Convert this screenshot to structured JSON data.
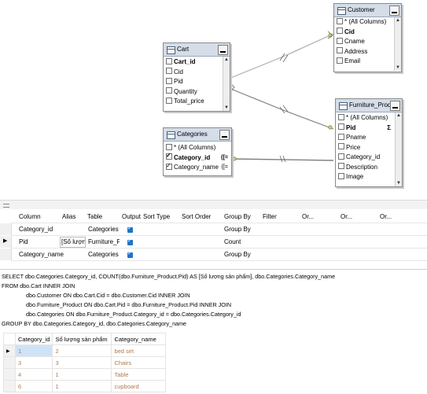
{
  "diagram": {
    "tables": [
      {
        "key": "customer",
        "title": "Customer",
        "rows": [
          {
            "label": "* (All Columns)",
            "checked": false,
            "bold": false
          },
          {
            "label": "Cid",
            "checked": false,
            "bold": true
          },
          {
            "label": "Cname",
            "checked": false,
            "bold": false
          },
          {
            "label": "Address",
            "checked": false,
            "bold": false
          },
          {
            "label": "Email",
            "checked": false,
            "bold": false
          }
        ]
      },
      {
        "key": "cart",
        "title": "Cart",
        "rows": [
          {
            "label": "Cart_id",
            "checked": false,
            "bold": true
          },
          {
            "label": "Cid",
            "checked": false,
            "bold": false
          },
          {
            "label": "Pid",
            "checked": false,
            "bold": false
          },
          {
            "label": "Quantity",
            "checked": false,
            "bold": false
          },
          {
            "label": "Total_price",
            "checked": false,
            "bold": false
          }
        ]
      },
      {
        "key": "categories",
        "title": "Categories",
        "rows": [
          {
            "label": "* (All Columns)",
            "checked": false,
            "bold": false
          },
          {
            "label": "Category_id",
            "checked": true,
            "bold": true
          },
          {
            "label": "Category_name",
            "checked": true,
            "bold": false
          }
        ]
      },
      {
        "key": "furniture",
        "title": "Furniture_Product",
        "rows": [
          {
            "label": "* (All Columns)",
            "checked": false,
            "bold": false
          },
          {
            "label": "Pid",
            "checked": false,
            "bold": true
          },
          {
            "label": "Pname",
            "checked": false,
            "bold": false
          },
          {
            "label": "Price",
            "checked": false,
            "bold": false
          },
          {
            "label": "Category_id",
            "checked": false,
            "bold": false
          },
          {
            "label": "Description",
            "checked": false,
            "bold": false
          },
          {
            "label": "Image",
            "checked": false,
            "bold": false
          }
        ]
      }
    ],
    "sigma": "Σ",
    "groupby_icon": "{[="
  },
  "grid": {
    "headers": [
      "Column",
      "Alias",
      "Table",
      "Output",
      "Sort Type",
      "Sort Order",
      "Group By",
      "Filter",
      "Or...",
      "Or...",
      "Or..."
    ],
    "rows": [
      {
        "column": "Category_id",
        "alias": "",
        "table": "Categories",
        "output": true,
        "group_by": "Group By"
      },
      {
        "column": "Pid",
        "alias": "[Số lượng...",
        "table": "Furniture_P...",
        "output": true,
        "group_by": "Count"
      },
      {
        "column": "Category_name",
        "alias": "",
        "table": "Categories",
        "output": true,
        "group_by": "Group By"
      }
    ]
  },
  "sql": {
    "lines": [
      "SELECT dbo.Categories.Category_id, COUNT(dbo.Furniture_Product.Pid) AS [Số lượng sản phẩm], dbo.Categories.Category_name",
      "FROM      dbo.Cart INNER JOIN",
      "dbo.Customer ON dbo.Cart.Cid = dbo.Customer.Cid INNER JOIN",
      "dbo.Furniture_Product ON dbo.Cart.Pid = dbo.Furniture_Product.Pid INNER JOIN",
      "dbo.Categories ON dbo.Furniture_Product.Category_id = dbo.Categories.Category_id",
      "GROUP BY dbo.Categories.Category_id, dbo.Categories.Category_name"
    ]
  },
  "results": {
    "headers": [
      "Category_id",
      "Số lượng sản phẩm",
      "Category_name"
    ],
    "rows": [
      [
        "1",
        "2",
        "bed set"
      ],
      [
        "3",
        "3",
        "Chairs"
      ],
      [
        "4",
        "1",
        "Table"
      ],
      [
        "6",
        "1",
        "cupboard"
      ]
    ]
  }
}
